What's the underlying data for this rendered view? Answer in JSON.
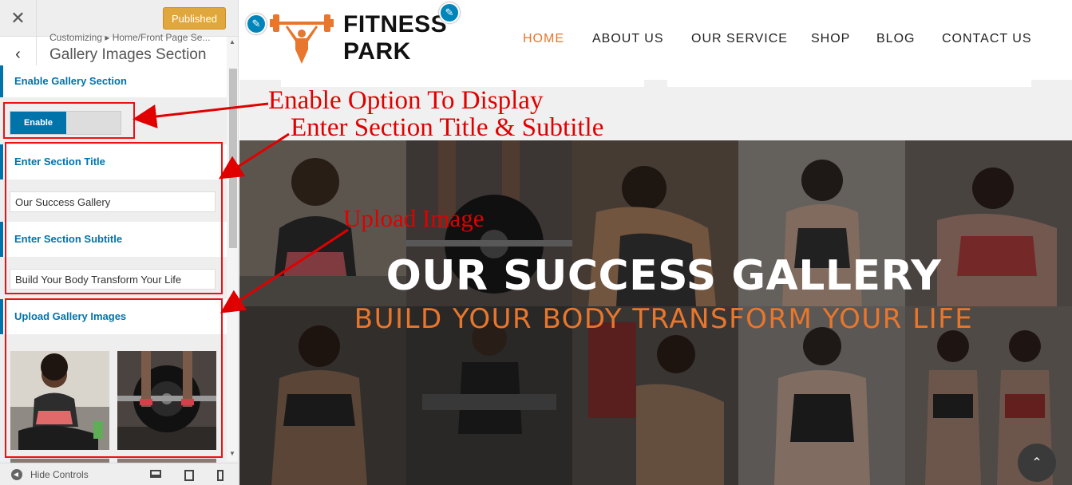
{
  "sidebar": {
    "close_glyph": "✕",
    "published_label": "Published",
    "back_glyph": "‹",
    "breadcrumb": "Customizing ▸ Home/Front Page Se...",
    "section_title": "Gallery Images Section",
    "enable_gallery": {
      "label": "Enable Gallery Section",
      "toggle_label": "Enable"
    },
    "section_title_control": {
      "label": "Enter Section Title",
      "value": "Our Success Gallery"
    },
    "section_subtitle_control": {
      "label": "Enter Section Subtitle",
      "value": "Build Your Body Transform Your Life"
    },
    "upload_images": {
      "label": "Upload Gallery Images"
    },
    "footer": {
      "hide_controls_label": "Hide Controls",
      "device_icons": [
        "desktop-icon",
        "tablet-icon",
        "mobile-icon"
      ]
    }
  },
  "preview": {
    "logo": {
      "line1": "FITNESS",
      "line2": "PARK",
      "icon": "dumbbell-figure-icon",
      "accent": "#e8762c"
    },
    "nav": [
      {
        "label": "HOME",
        "active": true
      },
      {
        "label": "ABOUT US",
        "active": false
      },
      {
        "label": "OUR SERVICE",
        "active": false
      },
      {
        "label": "SHOP",
        "active": false
      },
      {
        "label": "BLOG",
        "active": false
      },
      {
        "label": "CONTACT US",
        "active": false
      }
    ],
    "gallery": {
      "title": "OUR SUCCESS GALLERY",
      "subtitle": "BUILD YOUR BODY TRANSFORM YOUR LIFE"
    },
    "scroll_top_glyph": "⌃"
  },
  "annotations": {
    "enable_note": "Enable Option To Display",
    "title_note": "Enter Section Title & Subtitle",
    "upload_note": "Upload Image",
    "color": "#e00000"
  }
}
